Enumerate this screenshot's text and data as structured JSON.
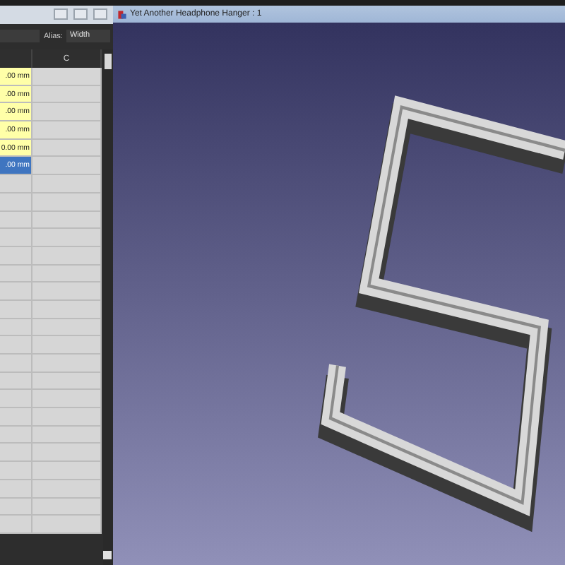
{
  "document_tab": {
    "title": "Yet Another Headphone Hanger : 1"
  },
  "alias": {
    "label": "Alias:",
    "value": "Width"
  },
  "table": {
    "columns": [
      "C"
    ],
    "rows": [
      {
        "value": ".00 mm",
        "selected": false
      },
      {
        "value": ".00 mm",
        "selected": false
      },
      {
        "value": ".00 mm",
        "selected": false
      },
      {
        "value": ".00 mm",
        "selected": false
      },
      {
        "value": "0.00 mm",
        "selected": false
      },
      {
        "value": ".00 mm",
        "selected": true
      }
    ]
  }
}
